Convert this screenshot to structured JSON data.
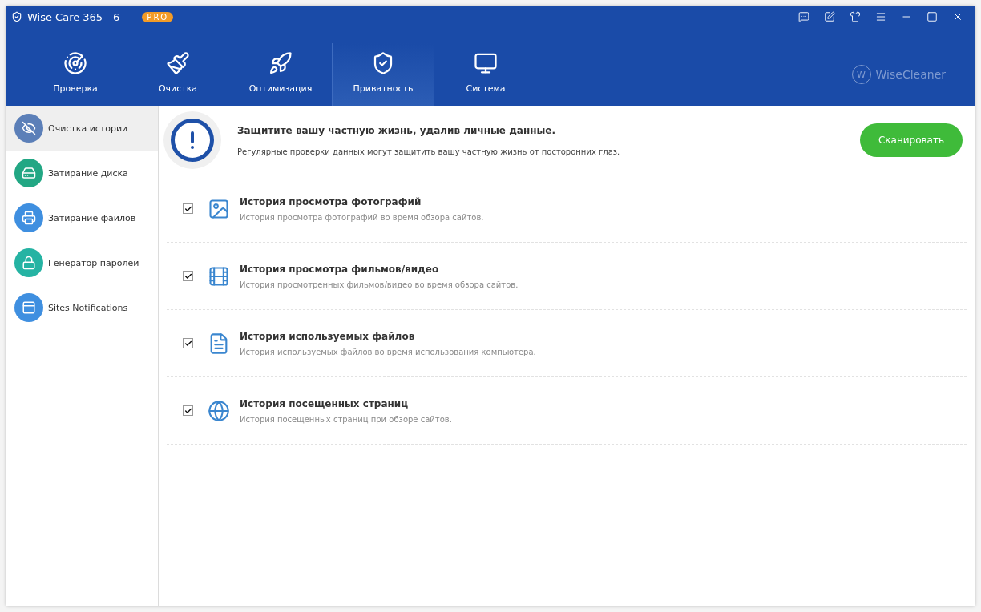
{
  "window": {
    "title": "Wise Care 365 - 6",
    "badge": "PRO"
  },
  "nav_tabs": [
    {
      "label": "Проверка",
      "selected": false
    },
    {
      "label": "Очистка",
      "selected": false
    },
    {
      "label": "Оптимизация",
      "selected": false
    },
    {
      "label": "Приватность",
      "selected": true
    },
    {
      "label": "Система",
      "selected": false
    }
  ],
  "brand": {
    "mark": "W",
    "name": "WiseCleaner"
  },
  "sidebar": {
    "items": [
      {
        "label": "Очистка истории",
        "color": "#5b7fb8",
        "selected": true
      },
      {
        "label": "Затирание диска",
        "color": "#22a784",
        "selected": false
      },
      {
        "label": "Затирание файлов",
        "color": "#3f8fe0",
        "selected": false
      },
      {
        "label": "Генератор паролей",
        "color": "#25b3a3",
        "selected": false
      },
      {
        "label": "Sites Notifications",
        "color": "#3f8fe0",
        "selected": false
      }
    ]
  },
  "banner": {
    "heading": "Защитите вашу частную жизнь, удалив личные данные.",
    "text": "Регулярные проверки данных могут защитить вашу частную жизнь от посторонних глаз.",
    "button": "Сканировать"
  },
  "items": [
    {
      "title": "История просмотра фотографий",
      "description": "История просмотра фотографий во время обзора сайтов.",
      "checked": true
    },
    {
      "title": "История просмотра фильмов/видео",
      "description": "История просмотренных фильмов/видео во время обзора сайтов.",
      "checked": true
    },
    {
      "title": "История используемых файлов",
      "description": "История используемых файлов во время использования компьютера.",
      "checked": true
    },
    {
      "title": "История посещенных страниц",
      "description": "История посещенных страниц при обзоре сайтов.",
      "checked": true
    }
  ]
}
